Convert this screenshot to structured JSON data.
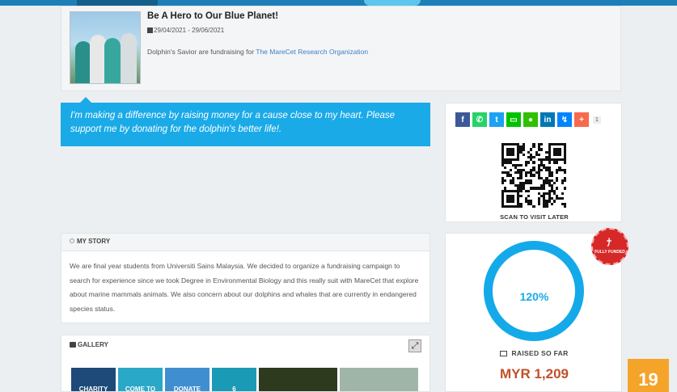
{
  "campaign": {
    "title": "Be A Hero to Our Blue Planet!",
    "dates": "29/04/2021 - 29/06/2021",
    "fundraiser_prefix": "Dolphin's Savior are fundraising for",
    "organization": "The MareCet Research Organization"
  },
  "quote": "I'm making a difference by raising money for a cause close to my heart. Please support me by donating for the dolphin's better life!.",
  "share": {
    "buttons": [
      {
        "name": "facebook",
        "glyph": "f",
        "color": "#3b5998"
      },
      {
        "name": "whatsapp",
        "glyph": "✆",
        "color": "#25d366"
      },
      {
        "name": "twitter",
        "glyph": "t",
        "color": "#1da1f2"
      },
      {
        "name": "line",
        "glyph": "▭",
        "color": "#00c300"
      },
      {
        "name": "wechat",
        "glyph": "●",
        "color": "#2dc100"
      },
      {
        "name": "linkedin",
        "glyph": "in",
        "color": "#0077b5"
      },
      {
        "name": "messenger",
        "glyph": "↯",
        "color": "#0084ff"
      },
      {
        "name": "addthis",
        "glyph": "+",
        "color": "#f8694d"
      }
    ],
    "count": "1",
    "qr_label": "SCAN TO VISIT LATER"
  },
  "story": {
    "heading": "MY STORY",
    "text": "We are final year students from Universiti Sains Malaysia. We decided to organize a fundraising campaign to search for experience since we took Degree in Environmental Biology and this really suit with MareCet that explore about marine mammals animals. We also concern about our dolphins and whales that are currently in endangered species status."
  },
  "gallery": {
    "heading": "GALLERY",
    "thumbs": [
      {
        "text": "CHARITY",
        "color": "#1e4a7a"
      },
      {
        "text": "COME TO",
        "color": "#2aa8c8"
      },
      {
        "text": "DONATE",
        "color": "#3f8fd0"
      },
      {
        "text": "6",
        "color": "#1a9ab5"
      },
      {
        "text": "",
        "color": "#2d3a1e"
      },
      {
        "text": "",
        "color": "#9fb5a8"
      }
    ]
  },
  "progress": {
    "percent": "120%",
    "raised_label": "RAISED SO FAR",
    "amount": "MYR 1,209",
    "badge_text": "FULLY FUNDED"
  },
  "tile": "19"
}
